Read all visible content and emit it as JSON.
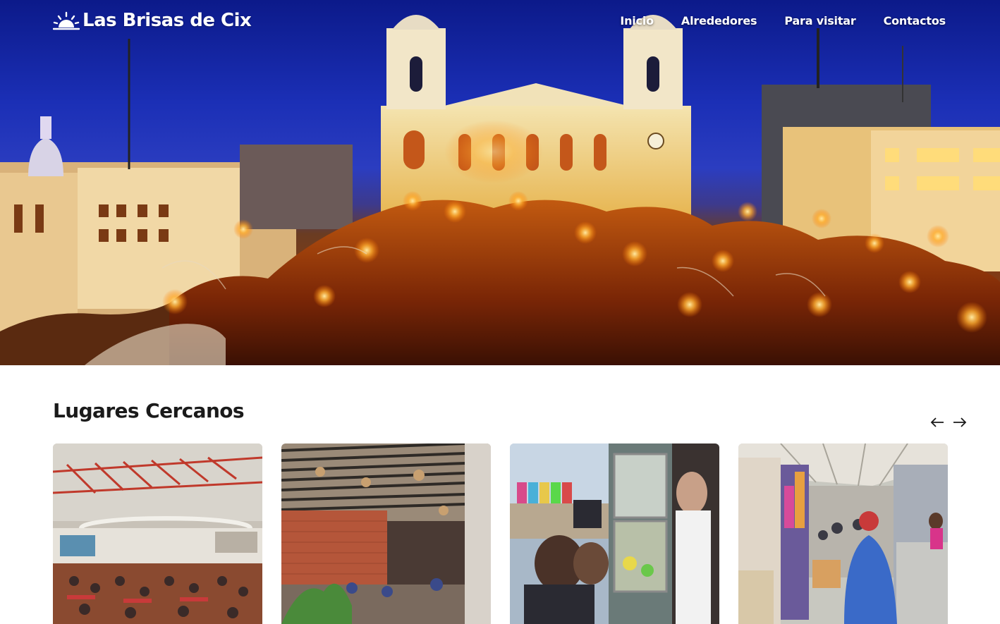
{
  "brand": {
    "name": "Las Brisas de Cix",
    "logo_icon": "sun-icon"
  },
  "nav": {
    "items": [
      {
        "label": "Inicio"
      },
      {
        "label": "Alrededores"
      },
      {
        "label": "Para visitar"
      },
      {
        "label": "Contactos"
      }
    ]
  },
  "hero": {
    "image": "night-cathedral-plaza-photo"
  },
  "section": {
    "title": "Lugares Cercanos",
    "prev_icon": "arrow-left-icon",
    "next_icon": "arrow-right-icon"
  },
  "cards": [
    {
      "image": "food-court-photo"
    },
    {
      "image": "covered-dining-patio-photo"
    },
    {
      "image": "street-food-stand-photo"
    },
    {
      "image": "market-corridor-photo"
    }
  ],
  "colors": {
    "text": "#1a1a1a",
    "nav_text": "#ffffff",
    "sky": "#1b2fb6",
    "lights": "#ffb020"
  }
}
